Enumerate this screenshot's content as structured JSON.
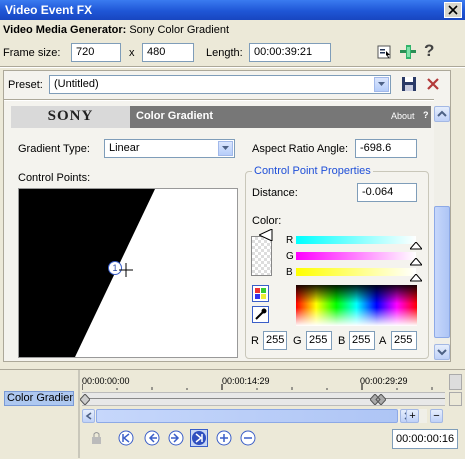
{
  "window": {
    "title": "Video Event FX"
  },
  "generator": {
    "label": "Video Media Generator:",
    "name": "Sony Color Gradient"
  },
  "frame": {
    "label": "Frame size:",
    "width": "720",
    "x_sep": "x",
    "height": "480",
    "length_label": "Length:",
    "length": "00:00:39:21"
  },
  "preset": {
    "label": "Preset:",
    "value": "(Untitled)"
  },
  "plugin": {
    "brand": "SONY",
    "name": "Color Gradient",
    "about": "About",
    "help": "?"
  },
  "gradient": {
    "type_label": "Gradient Type:",
    "type_value": "Linear",
    "aspect_label": "Aspect Ratio Angle:",
    "aspect_value": "-698.6"
  },
  "control_points": {
    "label": "Control Points:",
    "point_number": "1"
  },
  "cpp": {
    "title": "Control Point Properties",
    "distance_label": "Distance:",
    "distance_value": "-0.064",
    "color_label": "Color:"
  },
  "color": {
    "r_label": "R",
    "g_label": "G",
    "b_label": "B",
    "a_label": "A",
    "r_value": "255",
    "g_value": "255",
    "b_value": "255",
    "a_value": "255",
    "slider_r": "R",
    "slider_g": "G",
    "slider_b": "B"
  },
  "timeline": {
    "track_name": "Color Gradient",
    "times": [
      "00:00:00:00",
      "00:00:14:29",
      "00:00:29:29"
    ],
    "current_time": "00:00:00:16"
  }
}
